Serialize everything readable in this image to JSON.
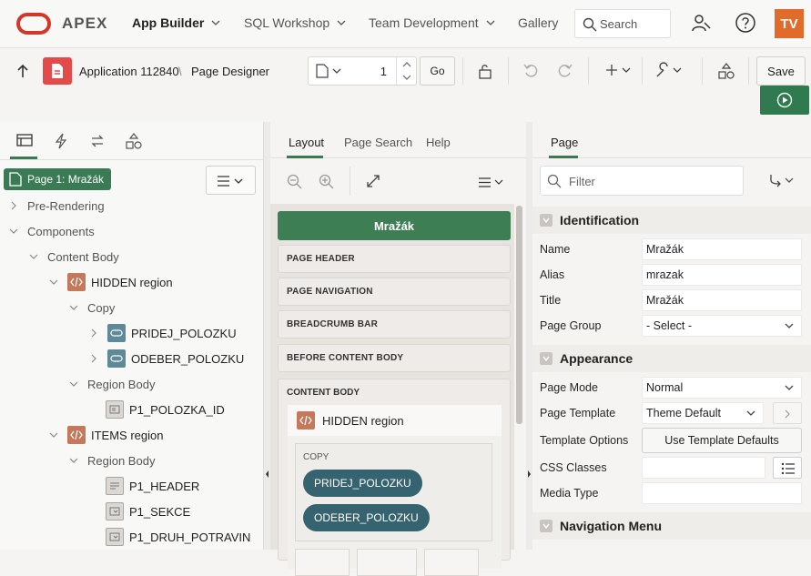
{
  "topbar": {
    "brand": "APEX",
    "nav": [
      {
        "label": "App Builder",
        "active": true
      },
      {
        "label": "SQL Workshop"
      },
      {
        "label": "Team Development"
      },
      {
        "label": "Gallery"
      }
    ],
    "search_placeholder": "Search",
    "avatar": "TV"
  },
  "toolbar": {
    "app": "Application 112840",
    "separator": "\\",
    "page_designer": "Page Designer",
    "page_number": "1",
    "go_label": "Go",
    "save_label": "Save"
  },
  "left": {
    "page_chip": "Page 1: Mražák",
    "tree": {
      "pre_rendering": "Pre-Rendering",
      "components": "Components",
      "content_body": "Content Body",
      "hidden_region": "HIDDEN region",
      "copy": "Copy",
      "pridej": "PRIDEJ_POLOZKU",
      "odeber": "ODEBER_POLOZKU",
      "region_body_1": "Region Body",
      "p1_polozka_id": "P1_POLOZKA_ID",
      "items_region": "ITEMS region",
      "region_body_2": "Region Body",
      "p1_header": "P1_HEADER",
      "p1_sekce": "P1_SEKCE",
      "p1_druh": "P1_DRUH_POTRAVIN"
    }
  },
  "middle": {
    "tabs": [
      "Layout",
      "Page Search",
      "Help"
    ],
    "page_title": "Mražák",
    "slots": [
      "PAGE HEADER",
      "PAGE NAVIGATION",
      "BREADCRUMB BAR",
      "BEFORE CONTENT BODY",
      "CONTENT BODY"
    ],
    "hidden_region": "HIDDEN region",
    "copy_label": "COPY",
    "buttons": [
      "PRIDEJ_POLOZKU",
      "ODEBER_POLOZKU"
    ]
  },
  "right": {
    "tab": "Page",
    "filter_placeholder": "Filter",
    "identification": {
      "title": "Identification",
      "name_label": "Name",
      "name_value": "Mražák",
      "alias_label": "Alias",
      "alias_value": "mrazak",
      "title_label": "Title",
      "title_value": "Mražák",
      "group_label": "Page Group",
      "group_value": "- Select -"
    },
    "appearance": {
      "title": "Appearance",
      "mode_label": "Page Mode",
      "mode_value": "Normal",
      "template_label": "Page Template",
      "template_value": "Theme Default",
      "options_label": "Template Options",
      "options_button": "Use Template Defaults",
      "css_label": "CSS Classes",
      "media_label": "Media Type"
    },
    "navigation": {
      "title": "Navigation Menu"
    }
  },
  "colors": {
    "brand_red": "#d2382a",
    "green": "#3e7e54",
    "teal": "#35636f",
    "avatar": "#e06b2b"
  }
}
